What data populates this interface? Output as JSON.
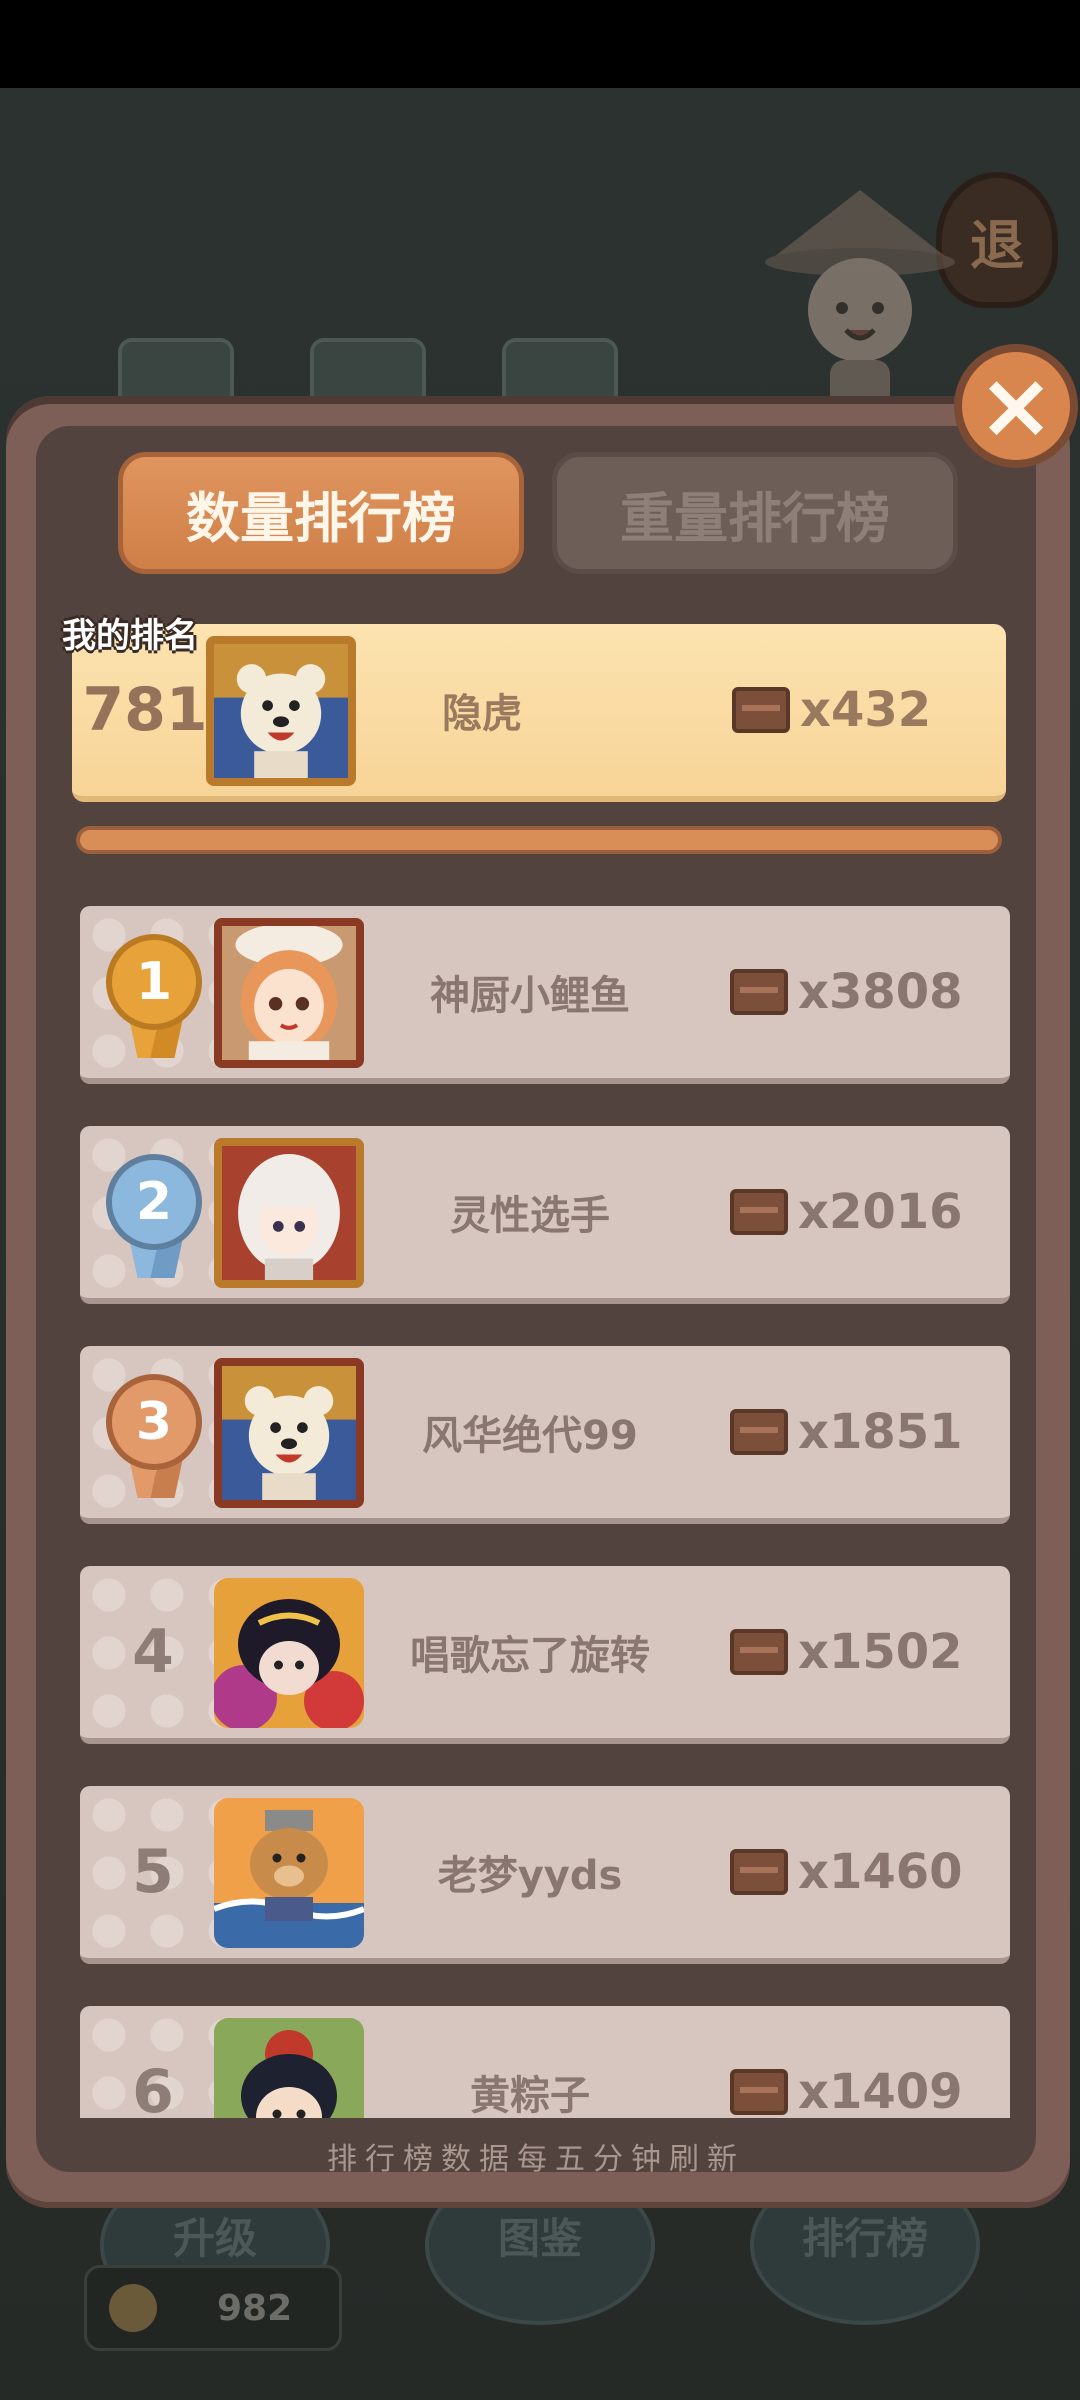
{
  "background": {
    "exit_label": "退",
    "bottom_buttons": [
      "升级",
      "图鉴",
      "排行榜"
    ],
    "coins": "982"
  },
  "close_label": "×",
  "tabs": {
    "quantity": "数量排行榜",
    "weight": "重量排行榜",
    "active": "quantity"
  },
  "my_rank": {
    "label": "我的排名",
    "rank": "781",
    "name": "隐虎",
    "score": "x432",
    "avatar": "polar-bear-avatar"
  },
  "leaderboard": [
    {
      "rank": "1",
      "name": "神厨小鲤鱼",
      "score": "x3808",
      "medal": "gold",
      "avatar": "chef-girl-avatar"
    },
    {
      "rank": "2",
      "name": "灵性选手",
      "score": "x2016",
      "medal": "silver",
      "avatar": "white-hair-girl-avatar"
    },
    {
      "rank": "3",
      "name": "风华绝代99",
      "score": "x1851",
      "medal": "bronze",
      "avatar": "polar-bear-avatar"
    },
    {
      "rank": "4",
      "name": "唱歌忘了旋转",
      "score": "x1502",
      "medal": "",
      "avatar": "dragon-warrior-avatar"
    },
    {
      "rank": "5",
      "name": "老梦yyds",
      "score": "x1460",
      "medal": "",
      "avatar": "bear-sailor-avatar"
    },
    {
      "rank": "6",
      "name": "黄粽子",
      "score": "x1409",
      "medal": "",
      "avatar": "black-hair-boy-avatar"
    }
  ],
  "footer_note": "排行榜数据每五分钟刷新",
  "colors": {
    "accent": "#d9854e",
    "panel": "#7d5f57",
    "panel_inner": "#52433f",
    "row": "#d7c6c0",
    "my_row": "#f7d497",
    "gold": "#e8a23a",
    "silver": "#8db8de",
    "bronze": "#e39a6a"
  }
}
